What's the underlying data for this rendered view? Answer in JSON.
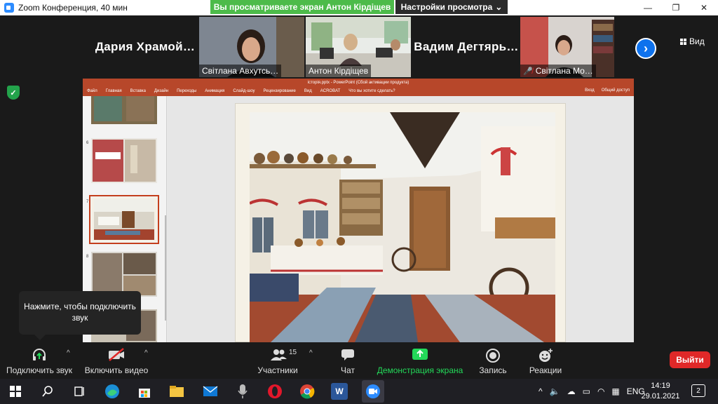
{
  "window": {
    "title": "Zoom Конференция, 40 мин",
    "minimize": "—",
    "maximize": "❐",
    "close": "✕"
  },
  "share_banner": "Вы просматриваете экран Антон Кірдіщев",
  "view_settings": {
    "label": "Настройки просмотра",
    "chevron": "⌄"
  },
  "participants": [
    {
      "name": "Дария  Храмой…",
      "has_video": false
    },
    {
      "name": "Світлана Авхутсь…",
      "has_video": true,
      "muted": false
    },
    {
      "name": "Антон Кірдіщев",
      "has_video": true,
      "muted": false
    },
    {
      "name": "Вадим  Дегтярь…",
      "has_video": false
    },
    {
      "name": "Світлана  Мо…",
      "has_video": true,
      "muted": true
    }
  ],
  "view_button": "Вид",
  "next_page_glyph": "›",
  "powerpoint": {
    "title": "історія.pptx - PowerPoint (Сбой активации продукта)",
    "tabs": [
      "Файл",
      "Главная",
      "Вставка",
      "Дизайн",
      "Переходы",
      "Анимация",
      "Слайд-шоу",
      "Рецензирование",
      "Вид",
      "ACROBAT",
      "Что вы хотите сделать?"
    ],
    "right_tabs": [
      "Вход",
      "Общий доступ"
    ],
    "slide_numbers": [
      "6",
      "7",
      "8"
    ],
    "selected_slide": "7"
  },
  "tooltip": "Нажмите, чтобы подключить звук",
  "controls": {
    "audio": "Подключить звук",
    "video": "Включить видео",
    "participants": "Участники",
    "participants_count": "15",
    "chat": "Чат",
    "share": "Демонстрация экрана",
    "record": "Запись",
    "reactions": "Реакции",
    "leave": "Выйти",
    "caret": "^"
  },
  "taskbar": {
    "language": "ENG",
    "time": "14:19",
    "date": "29.01.2021",
    "notifications": "2"
  },
  "colors": {
    "zoom_blue": "#0e72ed",
    "share_green": "#23d959",
    "leave_red": "#e02828",
    "ppt_red": "#b7472a"
  }
}
